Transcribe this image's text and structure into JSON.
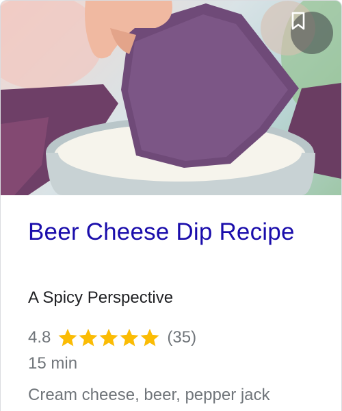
{
  "card": {
    "title": "Beer Cheese Dip Recipe",
    "source": "A Spicy Perspective",
    "rating": "4.8",
    "rating_value": 4.8,
    "rating_max": 5,
    "review_count": "(35)",
    "time": "15 min",
    "ingredients": "Cream cheese, beer, pepper jack",
    "image_icon": "bookmark-icon"
  },
  "colors": {
    "title_link": "#1a0dab",
    "secondary_text": "#70757a",
    "primary_text": "#202124",
    "star": "#fbbc04"
  }
}
